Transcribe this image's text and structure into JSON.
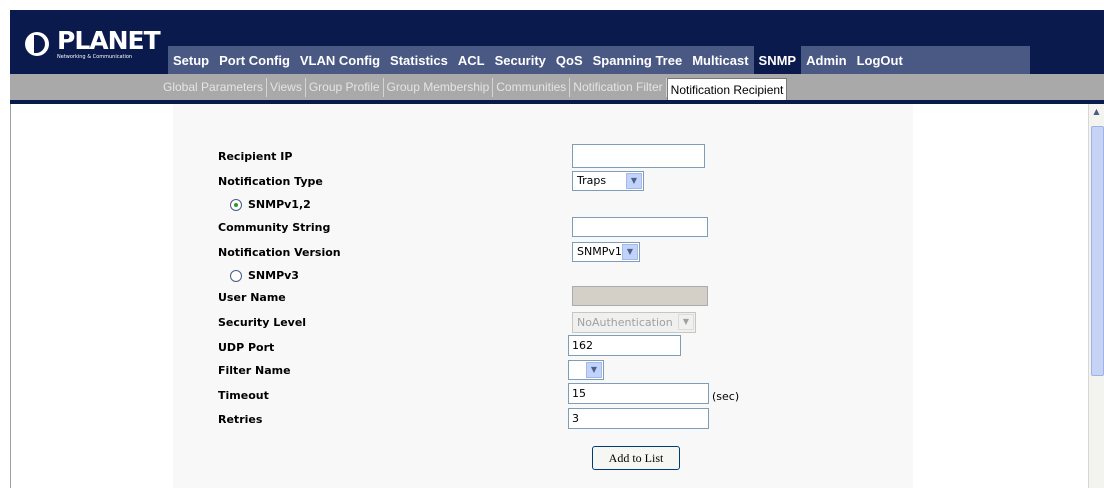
{
  "brand": {
    "name": "PLANET",
    "tagline": "Networking & Communication"
  },
  "main_nav": [
    {
      "label": "Setup",
      "active": false
    },
    {
      "label": "Port Config",
      "active": false
    },
    {
      "label": "VLAN Config",
      "active": false
    },
    {
      "label": "Statistics",
      "active": false
    },
    {
      "label": "ACL",
      "active": false
    },
    {
      "label": "Security",
      "active": false
    },
    {
      "label": "QoS",
      "active": false
    },
    {
      "label": "Spanning Tree",
      "active": false
    },
    {
      "label": "Multicast",
      "active": false
    },
    {
      "label": "SNMP",
      "active": true
    },
    {
      "label": "Admin",
      "active": false
    },
    {
      "label": "LogOut",
      "active": false
    }
  ],
  "sub_nav": [
    {
      "label": "Global Parameters",
      "active": false
    },
    {
      "label": "Views",
      "active": false
    },
    {
      "label": "Group Profile",
      "active": false
    },
    {
      "label": "Group Membership",
      "active": false
    },
    {
      "label": "Communities",
      "active": false
    },
    {
      "label": "Notification Filter",
      "active": false
    },
    {
      "label": "Notification Recipient",
      "active": true
    }
  ],
  "form": {
    "recipient_ip": {
      "label": "Recipient IP",
      "value": ""
    },
    "notification_type": {
      "label": "Notification Type",
      "value": "Traps"
    },
    "snmpv12": {
      "label": "SNMPv1,2",
      "checked": true
    },
    "community_string": {
      "label": "Community String",
      "value": ""
    },
    "notification_version": {
      "label": "Notification Version",
      "value": "SNMPv1"
    },
    "snmpv3": {
      "label": "SNMPv3",
      "checked": false
    },
    "user_name": {
      "label": "User Name",
      "value": ""
    },
    "security_level": {
      "label": "Security Level",
      "value": "NoAuthentication"
    },
    "udp_port": {
      "label": "UDP Port",
      "value": "162"
    },
    "filter_name": {
      "label": "Filter Name",
      "value": ""
    },
    "timeout": {
      "label": "Timeout",
      "value": "15",
      "unit": "(sec)"
    },
    "retries": {
      "label": "Retries",
      "value": "3"
    },
    "add_button": "Add to List"
  },
  "icons": {
    "dropdown": "chevron-down-icon",
    "scroll_up": "scroll-up-arrow-icon"
  },
  "colors": {
    "header": "#0b1a4d",
    "nav": "#4a5884",
    "subbar": "#a9a9a9"
  }
}
